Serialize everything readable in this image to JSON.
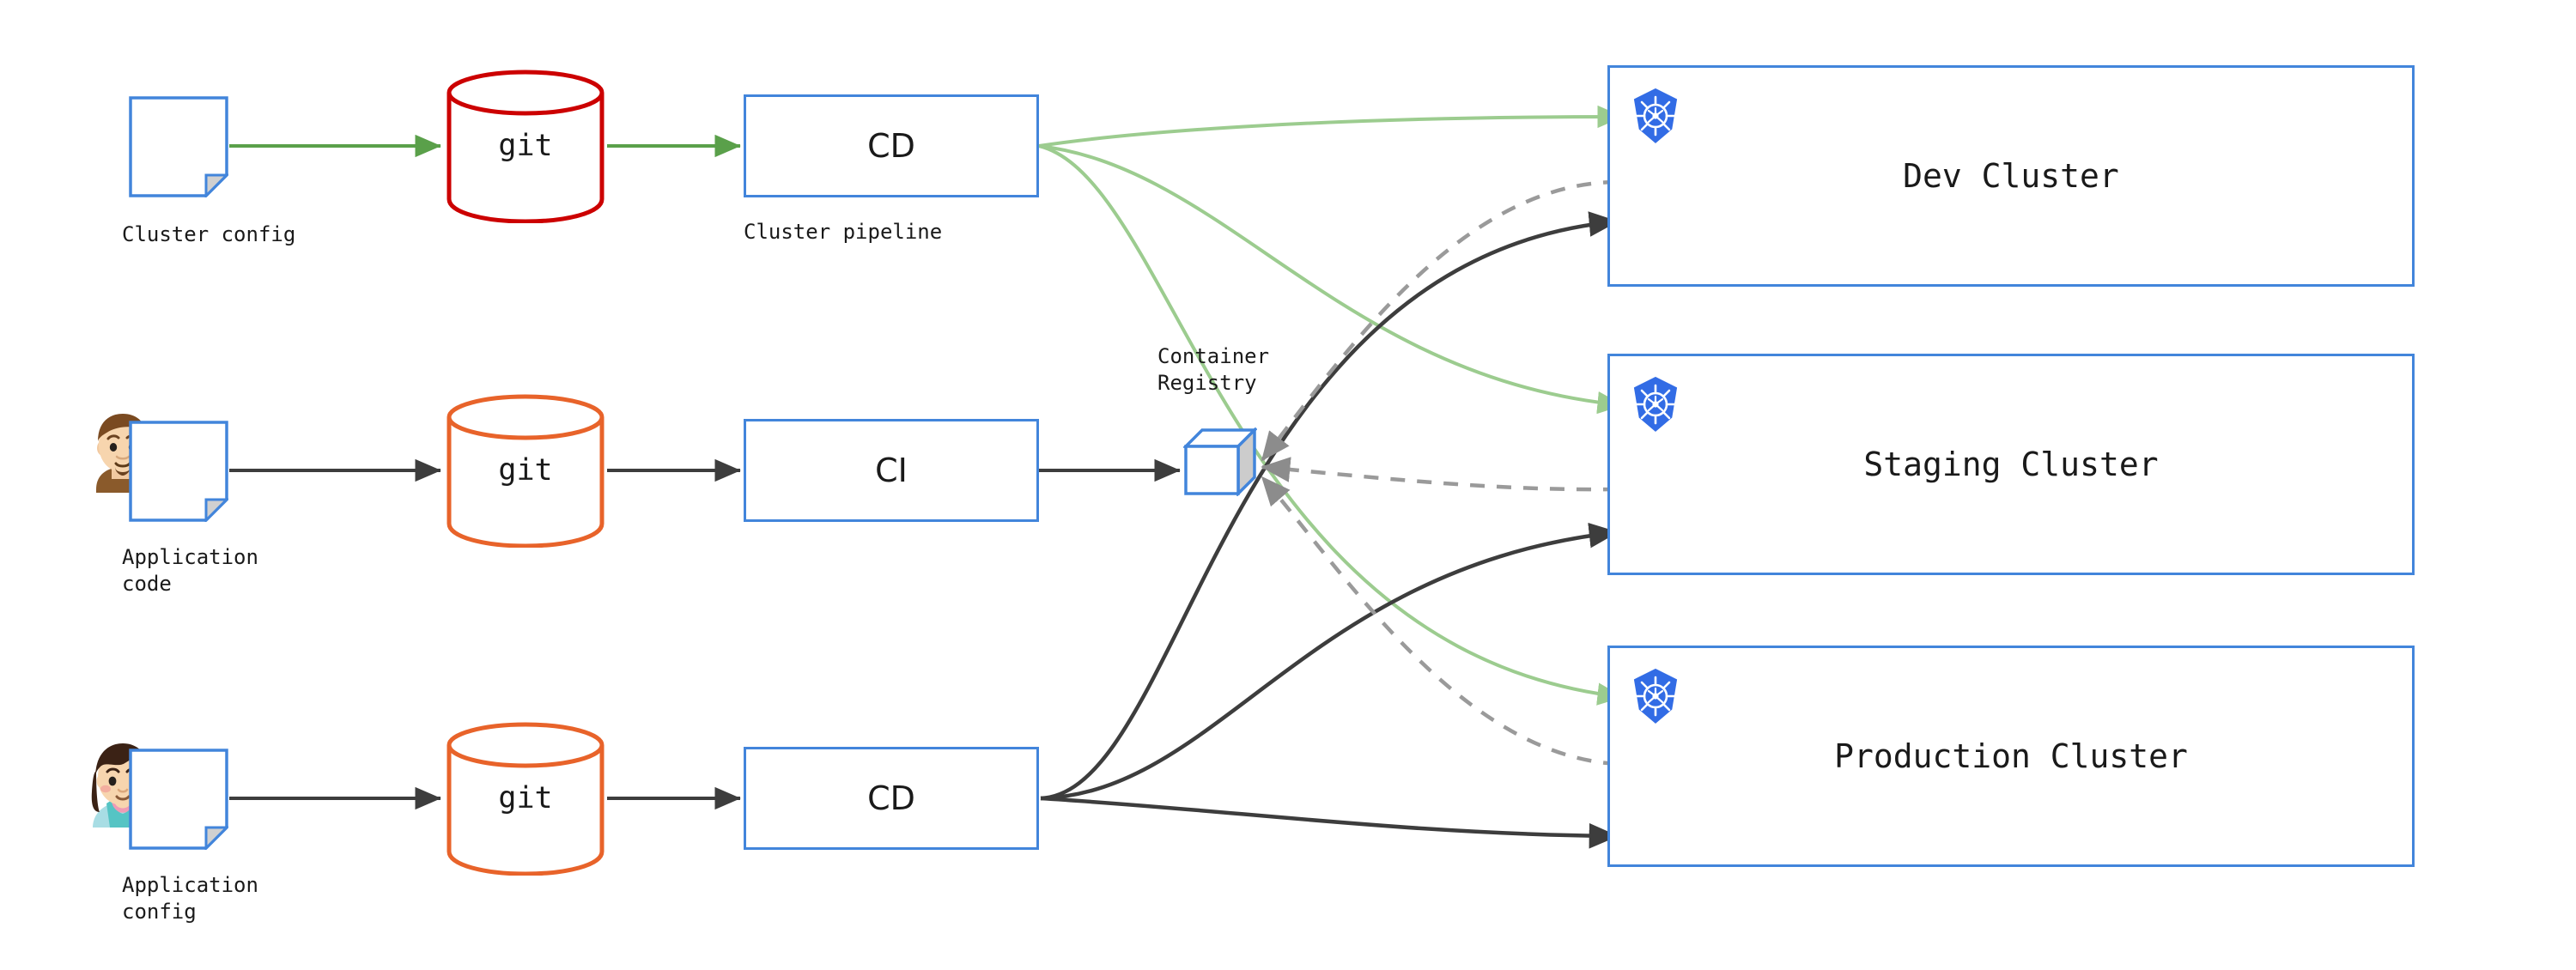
{
  "diagram": {
    "title": "GitOps CI/CD multi-cluster pipeline diagram",
    "colors": {
      "blue_outline": "#4285db",
      "git_red": "#cc0000",
      "git_orange": "#e8632a",
      "arrow_green": "#9ccc8f",
      "arrow_green_solid": "#5aa04a",
      "arrow_dark": "#3d3d3d",
      "arrow_dashed_gray": "#9a9a9a",
      "k8s_blue": "#326ce5",
      "cube_shade": "#cccccc"
    },
    "rows": [
      {
        "id": "cluster-config-row",
        "doc_label": "Cluster config",
        "repo_label": "git",
        "repo_color": "#cc0000",
        "pipeline_label": "CD",
        "pipeline_caption": "Cluster pipeline",
        "has_avatar": false
      },
      {
        "id": "application-code-row",
        "doc_label": "Application\ncode",
        "repo_label": "git",
        "repo_color": "#e8632a",
        "pipeline_label": "CI",
        "pipeline_caption": "",
        "has_avatar": true,
        "avatar_name": "male-developer-avatar"
      },
      {
        "id": "application-config-row",
        "doc_label": "Application\nconfig",
        "repo_label": "git",
        "repo_color": "#e8632a",
        "pipeline_label": "CD",
        "pipeline_caption": "",
        "has_avatar": true,
        "avatar_name": "female-developer-avatar"
      }
    ],
    "registry": {
      "caption": "Container\nRegistry",
      "icon": "cube-icon"
    },
    "clusters": [
      {
        "id": "dev-cluster",
        "label": "Dev Cluster",
        "icon": "kubernetes-icon"
      },
      {
        "id": "staging-cluster",
        "label": "Staging Cluster",
        "icon": "kubernetes-icon"
      },
      {
        "id": "production-cluster",
        "label": "Production Cluster",
        "icon": "kubernetes-icon"
      }
    ],
    "edges": [
      {
        "from": "cluster-config-doc",
        "to": "cluster-config-git",
        "style": "solid",
        "color": "#5aa04a"
      },
      {
        "from": "cluster-config-git",
        "to": "cluster-pipeline-cd",
        "style": "solid",
        "color": "#5aa04a"
      },
      {
        "from": "cluster-pipeline-cd",
        "to": "dev-cluster-k8s",
        "style": "solid",
        "color": "#9ccc8f"
      },
      {
        "from": "cluster-pipeline-cd",
        "to": "staging-cluster-k8s",
        "style": "solid",
        "color": "#9ccc8f"
      },
      {
        "from": "cluster-pipeline-cd",
        "to": "production-cluster-k8s",
        "style": "solid",
        "color": "#9ccc8f"
      },
      {
        "from": "application-code-doc",
        "to": "application-code-git",
        "style": "solid",
        "color": "#3d3d3d"
      },
      {
        "from": "application-code-git",
        "to": "ci-pipeline",
        "style": "solid",
        "color": "#3d3d3d"
      },
      {
        "from": "ci-pipeline",
        "to": "container-registry",
        "style": "solid",
        "color": "#3d3d3d"
      },
      {
        "from": "application-config-doc",
        "to": "application-config-git",
        "style": "solid",
        "color": "#3d3d3d"
      },
      {
        "from": "application-config-git",
        "to": "application-config-cd",
        "style": "solid",
        "color": "#3d3d3d"
      },
      {
        "from": "application-config-cd",
        "to": "dev-cluster",
        "style": "solid",
        "color": "#3d3d3d"
      },
      {
        "from": "application-config-cd",
        "to": "staging-cluster",
        "style": "solid",
        "color": "#3d3d3d"
      },
      {
        "from": "application-config-cd",
        "to": "production-cluster",
        "style": "solid",
        "color": "#3d3d3d"
      },
      {
        "from": "dev-cluster",
        "to": "container-registry",
        "style": "dashed",
        "color": "#9a9a9a"
      },
      {
        "from": "staging-cluster",
        "to": "container-registry",
        "style": "dashed",
        "color": "#9a9a9a"
      },
      {
        "from": "production-cluster",
        "to": "container-registry",
        "style": "dashed",
        "color": "#9a9a9a"
      }
    ]
  }
}
